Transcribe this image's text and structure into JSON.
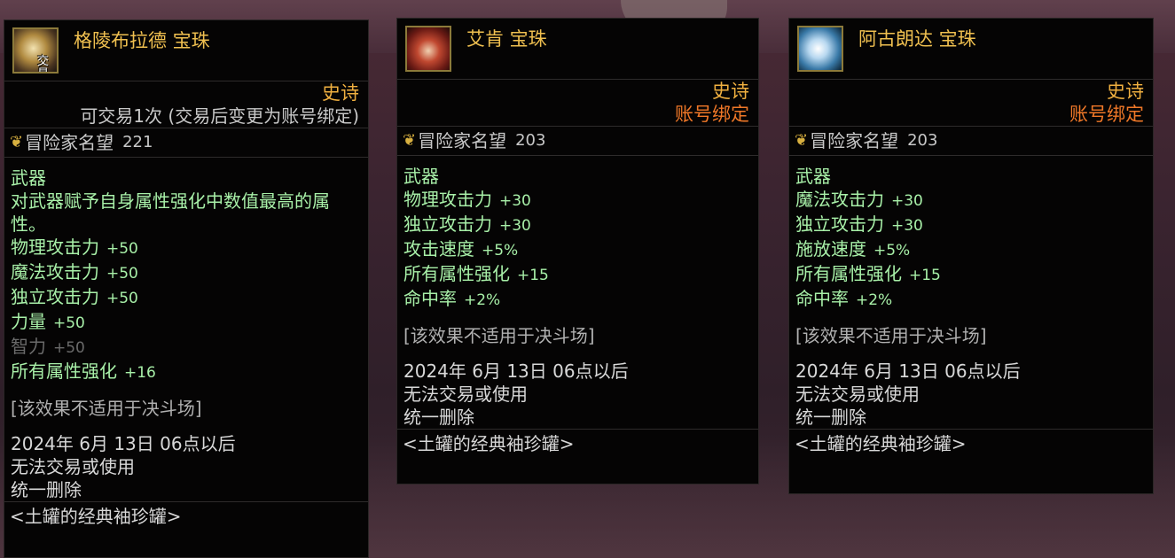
{
  "tooltips": [
    {
      "name": "格陵布拉德 宝珠",
      "trade_tag": "交易",
      "rarity": "史诗",
      "trade_note": "可交易1次 (交易后变更为账号绑定)",
      "reputation_label": "冒险家名望",
      "reputation_value": "221",
      "category": "武器",
      "description": "对武器赋予自身属性强化中数值最高的属性。",
      "stats": [
        {
          "label": "物理攻击力",
          "value": "+50"
        },
        {
          "label": "魔法攻击力",
          "value": "+50"
        },
        {
          "label": "独立攻击力",
          "value": "+50"
        },
        {
          "label": "力量",
          "value": "+50"
        },
        {
          "label": "智力",
          "value": "+50"
        },
        {
          "label": "所有属性强化",
          "value": "+16"
        }
      ],
      "note": "[该效果不适用于决斗场]",
      "expiry": [
        "2024年 6月 13日 06点以后",
        "无法交易或使用",
        "统一删除"
      ],
      "source": "<土罐的经典袖珍罐>"
    },
    {
      "name": "艾肯 宝珠",
      "rarity": "史诗",
      "bind": "账号绑定",
      "reputation_label": "冒险家名望",
      "reputation_value": "203",
      "category": "武器",
      "stats": [
        {
          "label": "物理攻击力",
          "value": "+30"
        },
        {
          "label": "独立攻击力",
          "value": "+30"
        },
        {
          "label": "攻击速度",
          "value": "+5%"
        },
        {
          "label": "所有属性强化",
          "value": "+15"
        },
        {
          "label": "命中率",
          "value": "+2%"
        }
      ],
      "note": "[该效果不适用于决斗场]",
      "expiry": [
        "2024年 6月 13日 06点以后",
        "无法交易或使用",
        "统一删除"
      ],
      "source": "<土罐的经典袖珍罐>"
    },
    {
      "name": "阿古朗达 宝珠",
      "rarity": "史诗",
      "bind": "账号绑定",
      "reputation_label": "冒险家名望",
      "reputation_value": "203",
      "category": "武器",
      "stats": [
        {
          "label": "魔法攻击力",
          "value": "+30"
        },
        {
          "label": "独立攻击力",
          "value": "+30"
        },
        {
          "label": "施放速度",
          "value": "+5%"
        },
        {
          "label": "所有属性强化",
          "value": "+15"
        },
        {
          "label": "命中率",
          "value": "+2%"
        }
      ],
      "note": "[该效果不适用于决斗场]",
      "expiry": [
        "2024年 6月 13日 06点以后",
        "无法交易或使用",
        "统一删除"
      ],
      "source": "<土罐的经典袖珍罐>"
    }
  ],
  "icons": [
    "orb-greenblad-icon",
    "orb-aiken-icon",
    "orb-agulanda-icon"
  ],
  "colors": {
    "item_name": "#f0c050",
    "rarity_epic": "#f0b040",
    "account_bind": "#f07828",
    "stat_green": "#a8f0a8",
    "inactive_stat": "#6a6a6a",
    "tooltip_bg": "#050404"
  }
}
